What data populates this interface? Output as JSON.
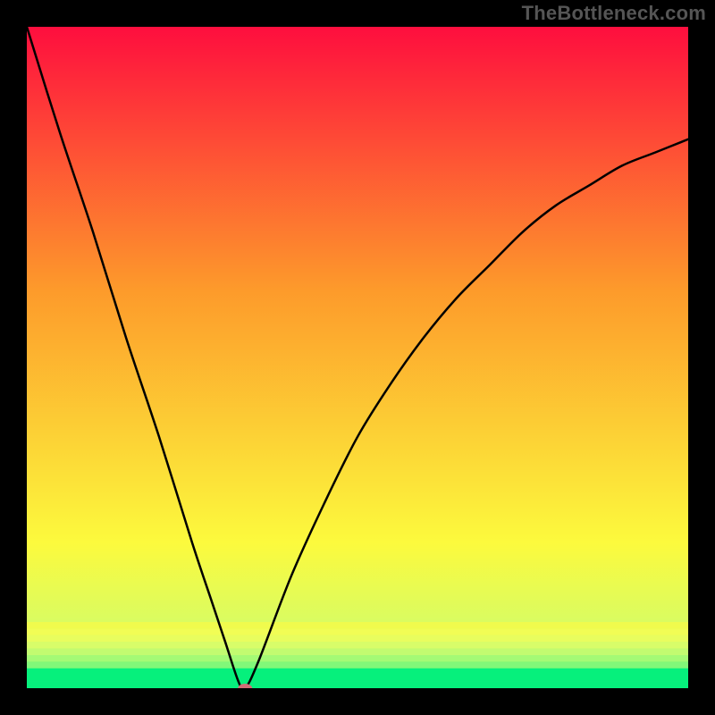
{
  "watermark": "TheBottleneck.com",
  "chart_data": {
    "type": "line",
    "title": "",
    "xlabel": "",
    "ylabel": "",
    "axes_visible": false,
    "grid": false,
    "background_gradient": {
      "top": "#fe0e3e",
      "mid_upper": "#fd9b2b",
      "mid_lower": "#fcfa3d",
      "near_bottom": "#d1fc6a",
      "bottom": "#06f07c"
    },
    "legend": false,
    "annotations": [],
    "xlim": [
      0,
      100
    ],
    "ylim": [
      0,
      100
    ],
    "series": [
      {
        "name": "bottleneck-curve",
        "color": "#000000",
        "x": [
          0,
          5,
          10,
          15,
          20,
          25,
          28,
          30,
          32,
          33,
          35,
          40,
          45,
          50,
          55,
          60,
          65,
          70,
          75,
          80,
          85,
          90,
          95,
          100
        ],
        "values": [
          100,
          84,
          69,
          53,
          38,
          22,
          13,
          7,
          1,
          0,
          4,
          17,
          28,
          38,
          46,
          53,
          59,
          64,
          69,
          73,
          76,
          79,
          81,
          83
        ]
      }
    ],
    "marker": {
      "name": "optimum-point",
      "x": 33,
      "y": 0,
      "color": "#d16d76",
      "rx": 8,
      "ry": 5
    },
    "bottom_bands": [
      {
        "y0": 90.0,
        "y1": 91.0,
        "color": "#f0fb4d"
      },
      {
        "y0": 91.0,
        "y1": 92.0,
        "color": "#f1fd55"
      },
      {
        "y0": 92.0,
        "y1": 93.0,
        "color": "#e8fd5e"
      },
      {
        "y0": 93.0,
        "y1": 94.0,
        "color": "#d8fd69"
      },
      {
        "y0": 94.0,
        "y1": 95.0,
        "color": "#c2fb70"
      },
      {
        "y0": 95.0,
        "y1": 96.0,
        "color": "#a4fa75"
      },
      {
        "y0": 96.0,
        "y1": 97.0,
        "color": "#81f879"
      },
      {
        "y0": 97.0,
        "y1": 99.0,
        "color": "#06f07c"
      },
      {
        "y0": 99.0,
        "y1": 100.0,
        "color": "#06f07c"
      }
    ]
  }
}
